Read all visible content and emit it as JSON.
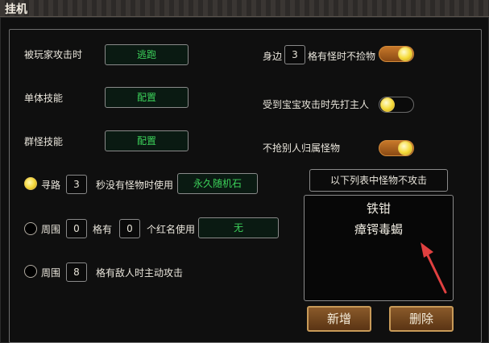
{
  "window": {
    "title": "挂机"
  },
  "left": {
    "pk_label": "被玩家攻击时",
    "pk_value": "逃跑",
    "single_skill_label": "单体技能",
    "single_skill_value": "配置",
    "group_skill_label": "群怪技能",
    "group_skill_value": "配置",
    "path": {
      "label": "寻路",
      "seconds": "3",
      "text": "秒没有怪物时使用",
      "item": "永久随机石",
      "selected": true
    },
    "around_red": {
      "label": "周围",
      "grid": "0",
      "has": "格有",
      "count": "0",
      "text": "个红名使用",
      "item": "无",
      "selected": false
    },
    "around_enemy": {
      "label": "周围",
      "grid": "8",
      "text": "格有敌人时主动攻击",
      "selected": false
    }
  },
  "right": {
    "nearby_label": "身边",
    "nearby_value": "3",
    "nearby_text": "格有怪时不捡物",
    "nearby_on": true,
    "pet_text": "受到宝宝攻击时先打主人",
    "pet_on": false,
    "no_steal_text": "不抢别人归属怪物",
    "no_steal_on": true,
    "list_header": "以下列表中怪物不攻击",
    "list_items": [
      "铁钳",
      "瘴锷毒蝎"
    ],
    "add_label": "新增",
    "delete_label": "删除"
  },
  "colors": {
    "green_text": "#3cd25a",
    "toggle_on": "#c7782a",
    "arrow": "#e04040"
  }
}
